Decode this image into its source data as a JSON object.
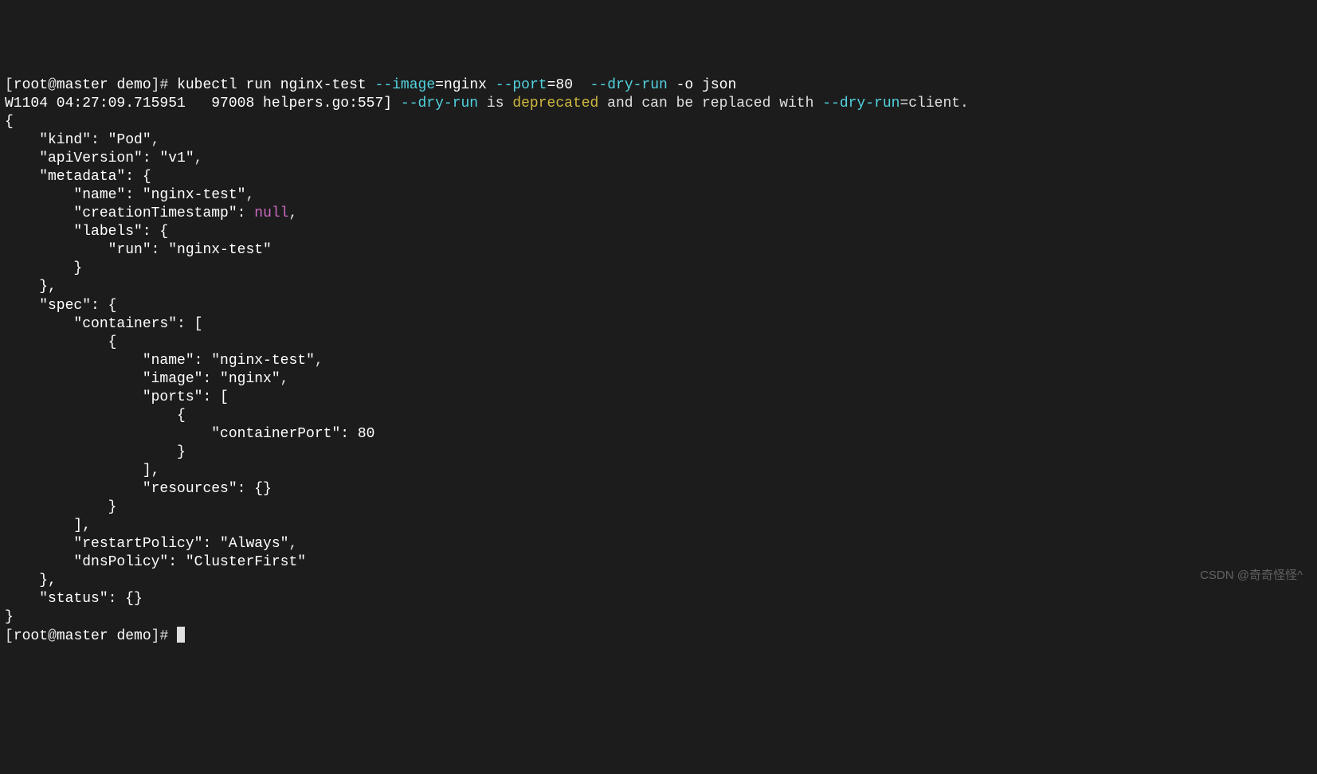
{
  "prompt1": {
    "open": "[",
    "user": "root",
    "at": "@",
    "host": "master",
    "path": " demo",
    "close": "]# "
  },
  "cmd1": {
    "part1": "kubectl run nginx-test ",
    "flag_image": "--image",
    "eq_nginx": "=nginx ",
    "flag_port": "--port",
    "eq_80": "=80  ",
    "flag_dryrun": "--dry-run",
    "space_o": " -o json"
  },
  "warn": {
    "prefix": "W1104 04:27:09.715951   97008 helpers.go:557] ",
    "flag": "--dry-run",
    "mid1": " is ",
    "deprecated": "deprecated",
    "mid2": " and can be replaced with ",
    "flag2": "--dry-run",
    "tail": "=client."
  },
  "json_lines": {
    "l1": "{",
    "l2_pre": "    \"kind\": ",
    "l2_val": "\"Pod\"",
    "l2_post": ",",
    "l3_pre": "    \"apiVersion\": ",
    "l3_val": "\"v1\"",
    "l3_post": ",",
    "l4": "    \"metadata\": {",
    "l5_pre": "        \"name\": ",
    "l5_val": "\"nginx-test\"",
    "l5_post": ",",
    "l6_pre": "        \"creationTimestamp\": ",
    "l6_null": "null",
    "l6_post": ",",
    "l7": "        \"labels\": {",
    "l8_pre": "            \"run\": ",
    "l8_val": "\"nginx-test\"",
    "l9": "        }",
    "l10": "    },",
    "l11": "    \"spec\": {",
    "l12": "        \"containers\": [",
    "l13": "            {",
    "l14_pre": "                \"name\": ",
    "l14_val": "\"nginx-test\"",
    "l14_post": ",",
    "l15_pre": "                \"image\": ",
    "l15_val": "\"nginx\"",
    "l15_post": ",",
    "l16": "                \"ports\": [",
    "l17": "                    {",
    "l18_pre": "                        \"containerPort\": ",
    "l18_val": "80",
    "l19": "                    }",
    "l20": "                ],",
    "l21": "                \"resources\": {}",
    "l22": "            }",
    "l23": "        ],",
    "l24_pre": "        \"restartPolicy\": ",
    "l24_val": "\"Always\"",
    "l24_post": ",",
    "l25_pre": "        \"dnsPolicy\": ",
    "l25_val": "\"ClusterFirst\"",
    "l26": "    },",
    "l27": "    \"status\": {}",
    "l28": "}"
  },
  "prompt2": {
    "open": "[",
    "user": "root",
    "at": "@",
    "host": "master",
    "path": " demo",
    "close": "]# "
  },
  "watermark": "CSDN @奇奇怪怪^"
}
